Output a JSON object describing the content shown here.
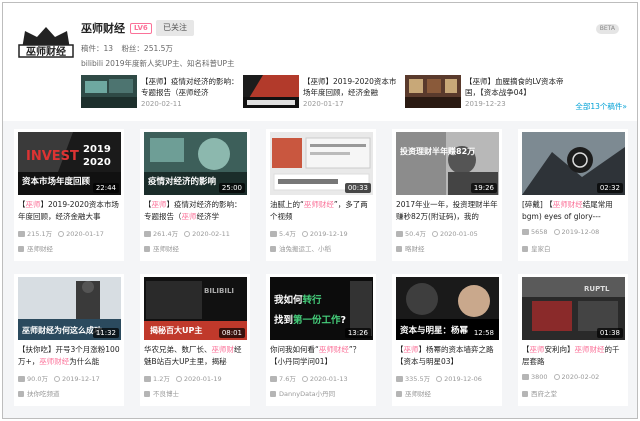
{
  "author": {
    "name": "巫师财经",
    "level": "LV6",
    "follow_label": "已关注",
    "beta": "BETA",
    "stats_videos": "稿件：13",
    "stats_fans": "粉丝：251.5万",
    "bio": "bilibili 2019年度新人奖UP主、知名科普UP主",
    "logo_text": "巫师财经"
  },
  "recent": [
    {
      "title_prefix": "【巫师】",
      "title": "疫情对经济的影响：专题报告（巫师经济",
      "date": "2020-02-11"
    },
    {
      "title_prefix": "【巫师】",
      "title": "2019-2020资本市场年度回顾，经济金融",
      "date": "2020-01-17"
    },
    {
      "title_prefix": "【巫师】",
      "title": "血腥摘食的LV资本帝国，【资本战争04】",
      "date": "2019-12-23"
    }
  ],
  "see_all": "全部13个稿件»",
  "videos": [
    {
      "pre": "【",
      "hl1": "巫师",
      "mid": "】2019-2020资本市场年度回顾，经济金融大事",
      "hl2": "",
      "post": "",
      "views": "215.1万",
      "date": "2020-01-17",
      "owner": "巫师财经",
      "duration": "22:44",
      "caption": "资本市场年度回顾"
    },
    {
      "pre": "【",
      "hl1": "巫师",
      "mid": "】疫情对经济的影响：专题报告（",
      "hl2": "巫师",
      "post": "经济学",
      "views": "261.4万",
      "date": "2020-02-11",
      "owner": "巫师财经",
      "duration": "25:00",
      "caption": "疫情对经济的影响"
    },
    {
      "pre": "油腻上的“",
      "hl1": "巫师财经",
      "mid": "”，多了两个视频",
      "hl2": "",
      "post": "",
      "views": "5.4万",
      "date": "2019-12-19",
      "owner": "油兔搬运工、小稻",
      "duration": "00:33",
      "caption": ""
    },
    {
      "pre": "2017年业一年，投资理财半年赚秒82万(附证码)，我的",
      "hl1": "",
      "mid": "",
      "hl2": "",
      "post": "",
      "views": "50.4万",
      "date": "2020-01-05",
      "owner": "略财经",
      "duration": "19:26",
      "caption": "投资理财半年赚82万"
    },
    {
      "pre": "[碎戴] 【",
      "hl1": "巫师财经",
      "mid": "结尾常用bgm) eyes of glory---",
      "hl2": "",
      "post": "",
      "views": "5658",
      "date": "2019-12-08",
      "owner": "皇家白",
      "duration": "02:32",
      "caption": ""
    },
    {
      "pre": "【扶你吃】开号3个月涨粉100万+，",
      "hl1": "巫师财经",
      "mid": "为什么能",
      "hl2": "",
      "post": "",
      "views": "90.0万",
      "date": "2019-12-17",
      "owner": "扶你吃频道",
      "duration": "11:32",
      "caption": "巫师财经为何这么成功"
    },
    {
      "pre": "华农兄弟、数厂长、",
      "hl1": "巫师财",
      "mid": "经魅",
      "hl2": "B站百大UP主里，揭秘",
      "post": "",
      "views": "1.2万",
      "date": "2020-01-19",
      "owner": "不良博士",
      "duration": "08:01",
      "caption": "揭秘百大UP主"
    },
    {
      "pre": "你问我如何看“",
      "hl1": "巫师财经",
      "mid": "”？【小丹同学问01】",
      "hl2": "",
      "post": "",
      "views": "7.6万",
      "date": "2020-01-13",
      "owner": "DannyData小丹同",
      "duration": "13:26",
      "caption": "我如何转行 找到第一份工作?"
    },
    {
      "pre": "【",
      "hl1": "巫师",
      "mid": "】杨幂的资本墙弈之路【资本与明星03】",
      "hl2": "",
      "post": "",
      "views": "335.5万",
      "date": "2019-12-06",
      "owner": "巫师财经",
      "duration": "12:58",
      "caption": "资本与明星：杨幂"
    },
    {
      "pre": "【",
      "hl1": "巫师",
      "mid": "安利向】",
      "hl2": "巫师财经",
      "post": "的千层套路",
      "views": "3800",
      "date": "2020-02-02",
      "owner": "西府之堂",
      "duration": "01:38",
      "caption": ""
    }
  ],
  "colors": {
    "accent": "#00a1d6",
    "pink": "#fb7299"
  }
}
